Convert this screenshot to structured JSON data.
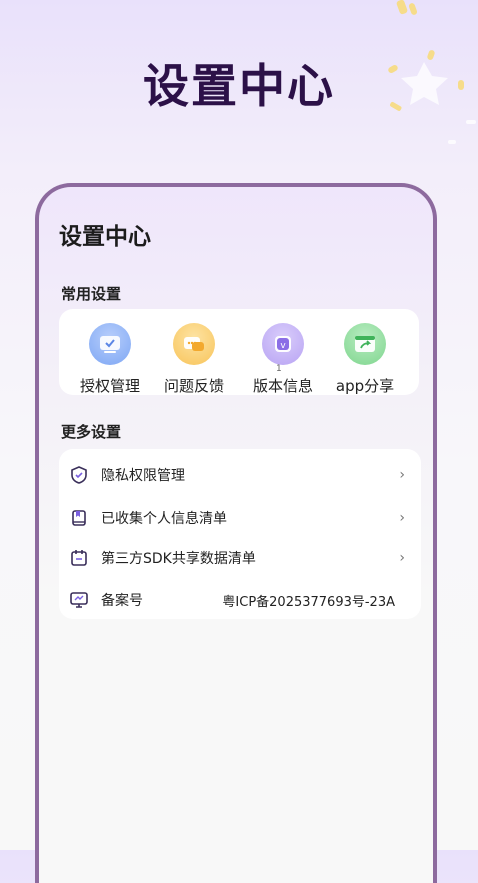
{
  "header": {
    "title": "设置中心"
  },
  "card": {
    "title": "设置中心",
    "common_label": "常用设置",
    "common_items": [
      {
        "label": "授权管理",
        "icon": "authorization-icon",
        "color": "#7ea7f4"
      },
      {
        "label": "问题反馈",
        "icon": "feedback-icon",
        "color": "#f8c45a"
      },
      {
        "label": "版本信息",
        "icon": "version-icon",
        "color": "#b8a3f3"
      },
      {
        "label": "app分享",
        "icon": "share-icon",
        "color": "#7fd68e"
      }
    ],
    "version_badge": "1",
    "more_label": "更多设置",
    "more_items": [
      {
        "label": "隐私权限管理",
        "icon": "shield-icon",
        "chevron": "›"
      },
      {
        "label": "已收集个人信息清单",
        "icon": "book-icon",
        "chevron": "›"
      },
      {
        "label": "第三方SDK共享数据清单",
        "icon": "calendar-icon",
        "chevron": "›"
      },
      {
        "label": "备案号",
        "icon": "monitor-icon",
        "value": "粤ICP备2025377693号-23A"
      }
    ]
  }
}
